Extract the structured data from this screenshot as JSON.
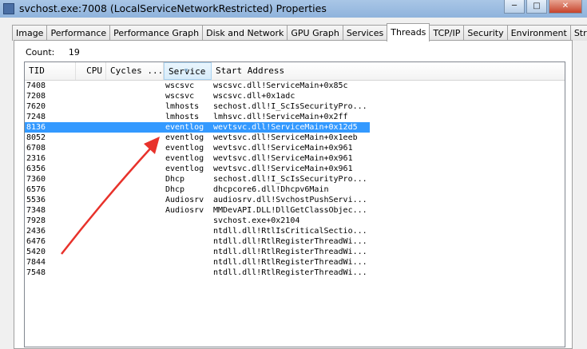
{
  "window": {
    "title": "svchost.exe:7008 (LocalServiceNetworkRestricted) Properties",
    "minimize": "─",
    "maximize": "□",
    "close": "✕"
  },
  "tabs": [
    {
      "label": "Image",
      "active": false
    },
    {
      "label": "Performance",
      "active": false
    },
    {
      "label": "Performance Graph",
      "active": false
    },
    {
      "label": "Disk and Network",
      "active": false
    },
    {
      "label": "GPU Graph",
      "active": false
    },
    {
      "label": "Services",
      "active": false
    },
    {
      "label": "Threads",
      "active": true
    },
    {
      "label": "TCP/IP",
      "active": false
    },
    {
      "label": "Security",
      "active": false
    },
    {
      "label": "Environment",
      "active": false
    },
    {
      "label": "Strings",
      "active": false
    }
  ],
  "count": {
    "label": "Count:",
    "value": "19"
  },
  "columns": [
    "TID",
    "CPU",
    "Cycles ...",
    "Service",
    "Start Address"
  ],
  "sorted_column": "Service",
  "selected_tid": "8136",
  "rows": [
    {
      "tid": "7408",
      "cpu": "",
      "cycles": "",
      "service": "wscsvc",
      "address": "wscsvc.dll!ServiceMain+0x85c"
    },
    {
      "tid": "7208",
      "cpu": "",
      "cycles": "",
      "service": "wscsvc",
      "address": "wscsvc.dll+0x1adc"
    },
    {
      "tid": "7620",
      "cpu": "",
      "cycles": "",
      "service": "lmhosts",
      "address": "sechost.dll!I_ScIsSecurityPro..."
    },
    {
      "tid": "7248",
      "cpu": "",
      "cycles": "",
      "service": "lmhosts",
      "address": "lmhsvc.dll!ServiceMain+0x2ff"
    },
    {
      "tid": "8136",
      "cpu": "",
      "cycles": "",
      "service": "eventlog",
      "address": "wevtsvc.dll!ServiceMain+0x12d5"
    },
    {
      "tid": "8052",
      "cpu": "",
      "cycles": "",
      "service": "eventlog",
      "address": "wevtsvc.dll!ServiceMain+0x1eeb"
    },
    {
      "tid": "6708",
      "cpu": "",
      "cycles": "",
      "service": "eventlog",
      "address": "wevtsvc.dll!ServiceMain+0x961"
    },
    {
      "tid": "2316",
      "cpu": "",
      "cycles": "",
      "service": "eventlog",
      "address": "wevtsvc.dll!ServiceMain+0x961"
    },
    {
      "tid": "6356",
      "cpu": "",
      "cycles": "",
      "service": "eventlog",
      "address": "wevtsvc.dll!ServiceMain+0x961"
    },
    {
      "tid": "7360",
      "cpu": "",
      "cycles": "",
      "service": "Dhcp",
      "address": "sechost.dll!I_ScIsSecurityPro..."
    },
    {
      "tid": "6576",
      "cpu": "",
      "cycles": "",
      "service": "Dhcp",
      "address": "dhcpcore6.dll!Dhcpv6Main"
    },
    {
      "tid": "5536",
      "cpu": "",
      "cycles": "",
      "service": "Audiosrv",
      "address": "audiosrv.dll!SvchostPushServi..."
    },
    {
      "tid": "7348",
      "cpu": "",
      "cycles": "",
      "service": "Audiosrv",
      "address": "MMDevAPI.DLL!DllGetClassObjec..."
    },
    {
      "tid": "7928",
      "cpu": "",
      "cycles": "",
      "service": "",
      "address": "svchost.exe+0x2104"
    },
    {
      "tid": "2436",
      "cpu": "",
      "cycles": "",
      "service": "",
      "address": "ntdll.dll!RtlIsCriticalSectio..."
    },
    {
      "tid": "6476",
      "cpu": "",
      "cycles": "",
      "service": "",
      "address": "ntdll.dll!RtlRegisterThreadWi..."
    },
    {
      "tid": "5420",
      "cpu": "",
      "cycles": "",
      "service": "",
      "address": "ntdll.dll!RtlRegisterThreadWi..."
    },
    {
      "tid": "7844",
      "cpu": "",
      "cycles": "",
      "service": "",
      "address": "ntdll.dll!RtlRegisterThreadWi..."
    },
    {
      "tid": "7548",
      "cpu": "",
      "cycles": "",
      "service": "",
      "address": "ntdll.dll!RtlRegisterThreadWi..."
    }
  ],
  "colors": {
    "selection": "#3399ff",
    "arrow": "#e8322b"
  }
}
